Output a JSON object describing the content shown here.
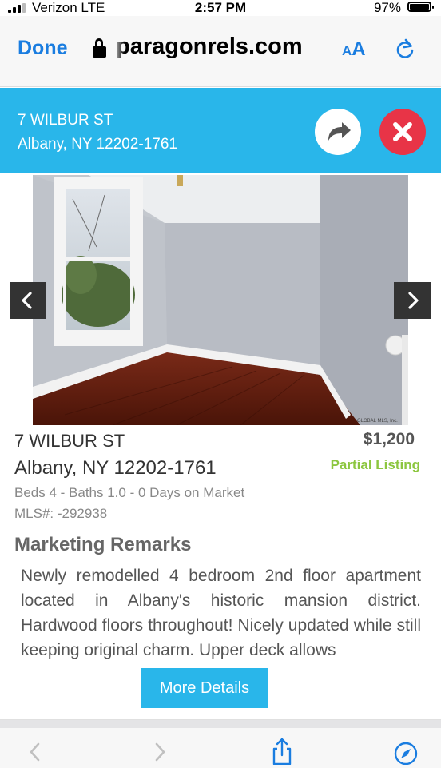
{
  "status_bar": {
    "carrier": "Verizon  LTE",
    "time": "2:57 PM",
    "battery": "97%",
    "battery_level": 0.97
  },
  "browser": {
    "done_label": "Done",
    "url": "paragonrels.com",
    "text_size_small": "A",
    "text_size_large": "A"
  },
  "listing_header": {
    "street": "7 WILBUR ST",
    "city_state_zip": "Albany, NY 12202-1761"
  },
  "listing": {
    "street": "7 WILBUR ST",
    "city_state_zip": "Albany, NY 12202-1761",
    "price": "$1,200",
    "listing_type": "Partial Listing",
    "facts": "Beds 4 - Baths 1.0 - 0 Days on Market",
    "mls": "MLS#: -292938",
    "photo_watermark": "GLOBAL MLS, Inc."
  },
  "marketing": {
    "title": "Marketing Remarks",
    "remarks": "Newly remodelled 4 bedroom 2nd floor apartment located in Albany's historic mansion district. Hardwood floors throughout! Nicely updated while still keeping original charm. Upper deck allows",
    "more_button": "More Details"
  },
  "colors": {
    "accent_blue": "#29b6ea",
    "ios_blue": "#1a7de0",
    "close_red": "#e83447",
    "partial_green": "#8cc63f"
  },
  "icons": {
    "share": "share-arrow-icon",
    "close": "close-x-icon",
    "prev": "chevron-left-icon",
    "next": "chevron-right-icon",
    "reload": "reload-icon",
    "lock": "lock-icon",
    "toolbar_back": "chevron-left-icon",
    "toolbar_forward": "chevron-right-icon",
    "toolbar_share": "share-icon",
    "toolbar_compass": "compass-icon"
  }
}
